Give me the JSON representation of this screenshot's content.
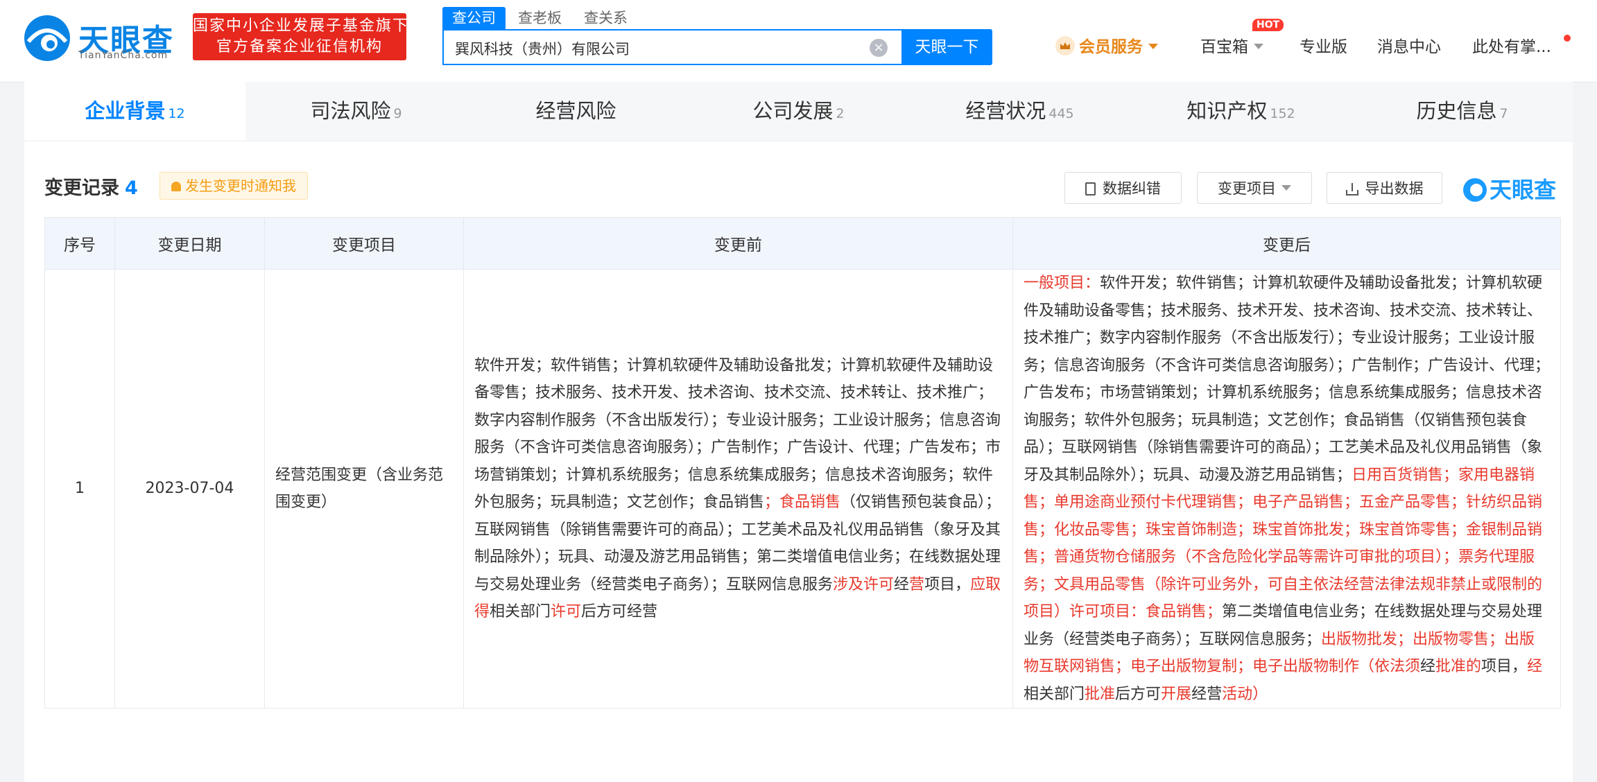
{
  "brand": {
    "name": "天眼查",
    "domain": "TianYanCha.com",
    "badge_line1": "国家中小企业发展子基金旗下",
    "badge_line2": "官方备案企业征信机构"
  },
  "search": {
    "tabs": [
      "查公司",
      "查老板",
      "查关系"
    ],
    "value": "巽风科技（贵州）有限公司",
    "button": "天眼一下"
  },
  "topnav": {
    "vip": "会员服务",
    "toolbox": "百宝箱",
    "hot": "HOT",
    "pro": "专业版",
    "messages": "消息中心",
    "user": "此处有掌..."
  },
  "tabs": [
    {
      "label": "企业背景",
      "count": "12"
    },
    {
      "label": "司法风险",
      "count": "9"
    },
    {
      "label": "经营风险",
      "count": ""
    },
    {
      "label": "公司发展",
      "count": "2"
    },
    {
      "label": "经营状况",
      "count": "445"
    },
    {
      "label": "知识产权",
      "count": "152"
    },
    {
      "label": "历史信息",
      "count": "7"
    }
  ],
  "section": {
    "title": "变更记录",
    "count": "4",
    "notify": "发生变更时通知我",
    "correct": "数据纠错",
    "filter": "变更项目",
    "export": "导出数据",
    "watermark": "天眼查"
  },
  "table": {
    "headers": [
      "序号",
      "变更日期",
      "变更项目",
      "变更前",
      "变更后"
    ],
    "rows": [
      {
        "index": "1",
        "date": "2023-07-04",
        "item": "经营范围变更（含业务范围变更）",
        "before": [
          {
            "t": "软件开发；软件销售；计算机软硬件及辅助设备批发；计算机软硬件及辅助设备零售；技术服务、技术开发、技术咨询、技术交流、技术转让、技术推广；数字内容制作服务（不含出版发行）；专业设计服务；工业设计服务；信息咨询服务（不含许可类信息咨询服务）；广告制作；广告设计、代理；广告发布；市场营销策划；计算机系统服务；信息系统集成服务；信息技术咨询服务；软件外包服务；玩具制造；文艺创作；食品销售",
            "red": false
          },
          {
            "t": "；食品销售",
            "red": true
          },
          {
            "t": "（仅销售预包装食品）；互联网销售（除销售需要许可的商品）；工艺美术品及礼仪用品销售（象牙及其制品除外）；玩具、动漫及游艺用品销售；第二类增值电信业务；在线数据处理与交易处理业务（经营类电子商务）；互联网信息服务",
            "red": false
          },
          {
            "t": "涉及许可",
            "red": true
          },
          {
            "t": "经",
            "red": false
          },
          {
            "t": "营",
            "red": true
          },
          {
            "t": "项目，",
            "red": false
          },
          {
            "t": "应取得",
            "red": true
          },
          {
            "t": "相关部门",
            "red": false
          },
          {
            "t": "许可",
            "red": true
          },
          {
            "t": "后方可经营",
            "red": false
          }
        ],
        "after": [
          {
            "t": "一般项目：",
            "red": true
          },
          {
            "t": "软件开发；软件销售；计算机软硬件及辅助设备批发；计算机软硬件及辅助设备零售；技术服务、技术开发、技术咨询、技术交流、技术转让、技术推广；数字内容制作服务（不含出版发行）；专业设计服务；工业设计服务；信息咨询服务（不含许可类信息咨询服务）；广告制作；广告设计、代理；广告发布；市场营销策划；计算机系统服务；信息系统集成服务；信息技术咨询服务；软件外包服务；玩具制造；文艺创作；食品销售（仅销售预包装食品）；互联网销售（除销售需要许可的商品）；工艺美术品及礼仪用品销售（象牙及其制品除外）；玩具、动漫及游艺用品销售；",
            "red": false
          },
          {
            "t": "日用百货销售；家用电器销售；单用途商业预付卡代理销售；电子产品销售；五金产品零售；针纺织品销售；化妆品零售；珠宝首饰制造；珠宝首饰批发；珠宝首饰零售；金银制品销售；普通货物仓储服务（不含危险化学品等需许可审批的项目）；票务代理服务；文具用品零售（除许可业务外，可自主依法经营法律法规非禁止或限制的项目）许可项目：食品销售；",
            "red": true
          },
          {
            "t": "第二类增值电信业务；在线数据处理与交易处理业务（经营类电子商务）；互联网信息服务；",
            "red": false
          },
          {
            "t": "出版物批发；出版物零售；出版物互联网销售；电子出版物复制；电子出版物制作（依法须",
            "red": true
          },
          {
            "t": "经",
            "red": false
          },
          {
            "t": "批准的",
            "red": true
          },
          {
            "t": "项目，",
            "red": false
          },
          {
            "t": "经",
            "red": true
          },
          {
            "t": "相关部门",
            "red": false
          },
          {
            "t": "批准",
            "red": true
          },
          {
            "t": "后方可",
            "red": false
          },
          {
            "t": "开展",
            "red": true
          },
          {
            "t": "经营",
            "red": false
          },
          {
            "t": "活动）",
            "red": true
          }
        ]
      }
    ]
  }
}
